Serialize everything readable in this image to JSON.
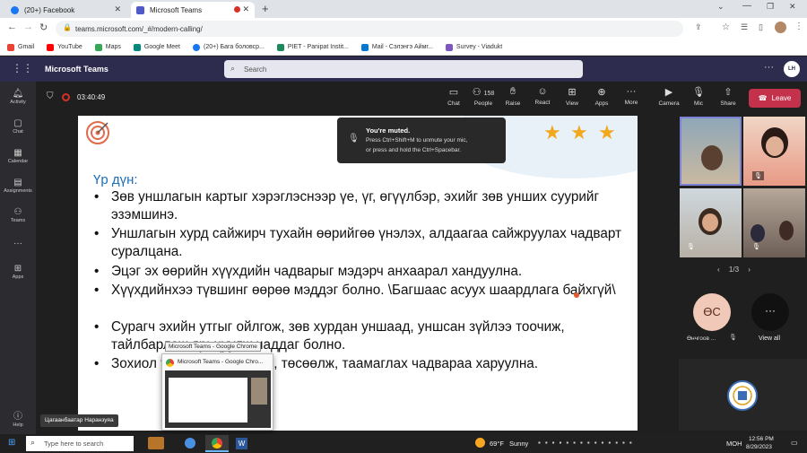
{
  "browser": {
    "tabs": [
      {
        "label": "(20+) Facebook"
      },
      {
        "label": "Microsoft Teams"
      }
    ],
    "url": "teams.microsoft.com/_#/modern-calling/",
    "bookmarks": [
      "Gmail",
      "YouTube",
      "Maps",
      "Google Meet",
      "(20+) Бага боловср...",
      "PIET - Panipat Instit...",
      "Mail - Сэлэнгэ Аймг...",
      "Survey - Viadukt"
    ]
  },
  "teams": {
    "app_name": "Microsoft Teams",
    "search_placeholder": "Search",
    "user_initials": "LH",
    "rail": [
      "Activity",
      "Chat",
      "Calendar",
      "Assignments",
      "Teams",
      "Apps",
      "Help"
    ],
    "timer": "03:40:49",
    "controls": {
      "chat": "Chat",
      "people": "People",
      "people_count": "158",
      "raise": "Raise",
      "react": "React",
      "view": "View",
      "apps": "Apps",
      "more": "More",
      "camera": "Camera",
      "mic": "Mic",
      "share": "Share",
      "leave": "Leave"
    },
    "muted_toast": {
      "title": "You're muted.",
      "line1": "Press Ctrl+Shift+M to unmute your mic,",
      "line2": "or press and hold the Ctrl+Spacebar."
    },
    "pager": "1/3",
    "participant_initials": "ӨС",
    "participant_name": "Өнчгоов ...",
    "view_all": "View all",
    "presenter_name": "Цагаанбаатар Наранзуяа"
  },
  "slide": {
    "title": "Үр дүн:",
    "bullets": [
      "Зөв уншлагын картыг хэрэглэснээр үе, үг, өгүүлбэр, эхийг зөв унших суурийг эзэмшинэ.",
      "Уншлагын хурд сайжирч тухайн өөрийгөө үнэлэх, алдаагаа сайжруулах чадварт суралцана.",
      "Эцэг эх өөрийн хүүхдийн чадварыг мэдэрч анхаарал хандуулна.",
      "Хүүхдийнхээ түвшинг өөрөө мэддэг болно. \\Багшаас асуух шаардлага байхгүй\\",
      "Сурагч эхийн утгыг ойлгож, зөв хурдан уншаад, уншсан зүйлээ тоочиж, тайлбарлаж ярьцуулж чаддаг болно.",
      "Зохиол тэс гүнзгийрүүлэх, төсөөлж, таамаглах чадвараа харуулна."
    ]
  },
  "popup": {
    "tooltip": "Microsoft Teams - Google Chrome",
    "title": "Microsoft Teams - Google Chro..."
  },
  "taskbar": {
    "search_placeholder": "Type here to search",
    "weather_temp": "69°F",
    "weather_desc": "Sunny",
    "lang": "МОН",
    "time": "12:56 PM",
    "date": "8/29/2023"
  }
}
